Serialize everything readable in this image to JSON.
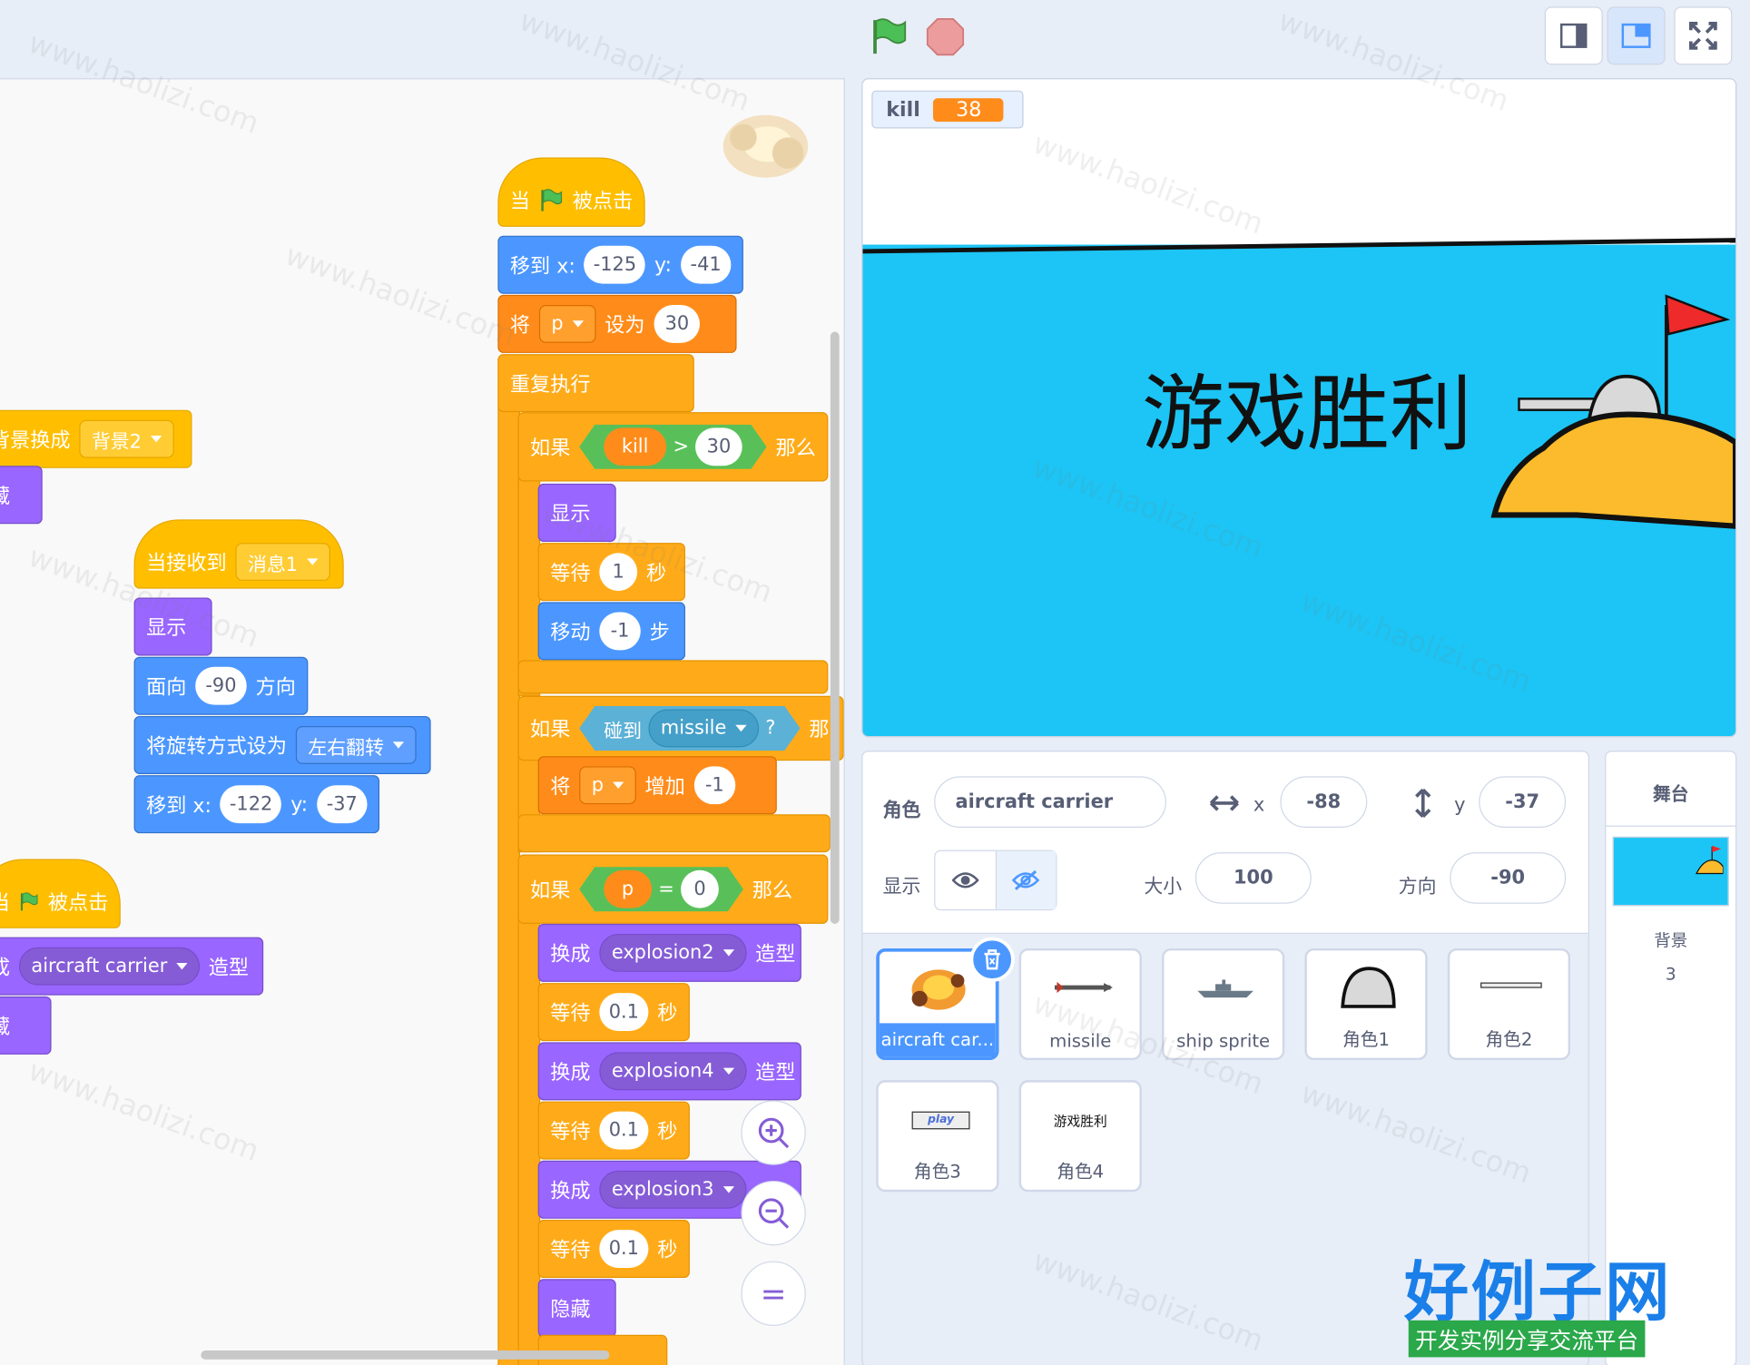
{
  "toolbar": {
    "green_flag": "green-flag-icon",
    "stop": "stop-icon"
  },
  "code": {
    "script1": {
      "backdrop_label": "背景换成",
      "backdrop_value": "背景2",
      "hide_partial": "藏"
    },
    "script2": {
      "hat_label": "当接收到",
      "hat_value": "消息1",
      "show": "显示",
      "point_label": "面向",
      "point_value": "-90",
      "point_suffix": "方向",
      "rotation_label": "将旋转方式设为",
      "rotation_value": "左右翻转",
      "goto_label": "移到 x:",
      "goto_x": "-122",
      "goto_y_label": "y:",
      "goto_y": "-37"
    },
    "script3": {
      "hat_left": "当",
      "hat_right": "被点击",
      "costume_prefix": "成",
      "costume_value": "aircraft carrier",
      "costume_suffix": "造型",
      "hide_partial": "藏"
    },
    "script4": {
      "hat_left": "当",
      "hat_right": "被点击",
      "goto_label": "移到 x:",
      "goto_x": "-125",
      "goto_y_label": "y:",
      "goto_y": "-41",
      "set_label": "将",
      "set_var": "p",
      "set_mid": "设为",
      "set_value": "30",
      "forever": "重复执行",
      "if1_label": "如果",
      "if1_var": "kill",
      "if1_op": ">",
      "if1_value": "30",
      "if1_then": "那么",
      "if1_show": "显示",
      "wait1_label": "等待",
      "wait1_value": "1",
      "wait1_unit": "秒",
      "move_label": "移动",
      "move_value": "-1",
      "move_unit": "步",
      "if2_label": "如果",
      "if2_touch": "碰到",
      "if2_obj": "missile",
      "if2_q": "?",
      "if2_then": "那",
      "change_label": "将",
      "change_var": "p",
      "change_mid": "增加",
      "change_value": "-1",
      "if3_label": "如果",
      "if3_var": "p",
      "if3_op": "=",
      "if3_value": "0",
      "if3_then": "那么",
      "sw1_label": "换成",
      "sw1_value": "explosion2",
      "sw1_suffix": "造型",
      "w2_label": "等待",
      "w2_value": "0.1",
      "w2_unit": "秒",
      "sw2_label": "换成",
      "sw2_value": "explosion4",
      "sw2_suffix": "造型",
      "w3_label": "等待",
      "w3_value": "0.1",
      "w3_unit": "秒",
      "sw3_label": "换成",
      "sw3_value": "explosion3",
      "sw3_suffix": "造型",
      "w4_label": "等待",
      "w4_value": "0.1",
      "w4_unit": "秒",
      "hide": "隐藏"
    },
    "zoom_reset": "="
  },
  "stage": {
    "monitor_name": "kill",
    "monitor_value": "38",
    "win_text": "游戏胜利"
  },
  "sprite_info": {
    "sprite_label": "角色",
    "sprite_name": "aircraft carrier",
    "x_label": "x",
    "x_value": "-88",
    "y_label": "y",
    "y_value": "-37",
    "show_label": "显示",
    "size_label": "大小",
    "size_value": "100",
    "direction_label": "方向",
    "direction_value": "-90"
  },
  "sprites": [
    {
      "name": "aircraft car..."
    },
    {
      "name": "missile"
    },
    {
      "name": "ship sprite"
    },
    {
      "name": "角色1"
    },
    {
      "name": "角色2"
    },
    {
      "name": "角色3",
      "thumb_text": "play"
    },
    {
      "name": "角色4",
      "thumb_text": "游戏胜利"
    }
  ],
  "stage_panel": {
    "title": "舞台",
    "backdrops_label": "背景",
    "backdrops_count": "3"
  },
  "watermark": {
    "text": "www.haolizi.com",
    "logo_text": "好例子网",
    "logo_sub": "开发实例分享交流平台"
  },
  "colors": {
    "events": "#ffbf00",
    "control": "#ffab19",
    "looks": "#9966ff",
    "motion": "#4c97ff",
    "variables": "#ff8c1a",
    "operators": "#59c059",
    "sensing": "#5cb1d6",
    "sea": "#1cc5f5"
  }
}
